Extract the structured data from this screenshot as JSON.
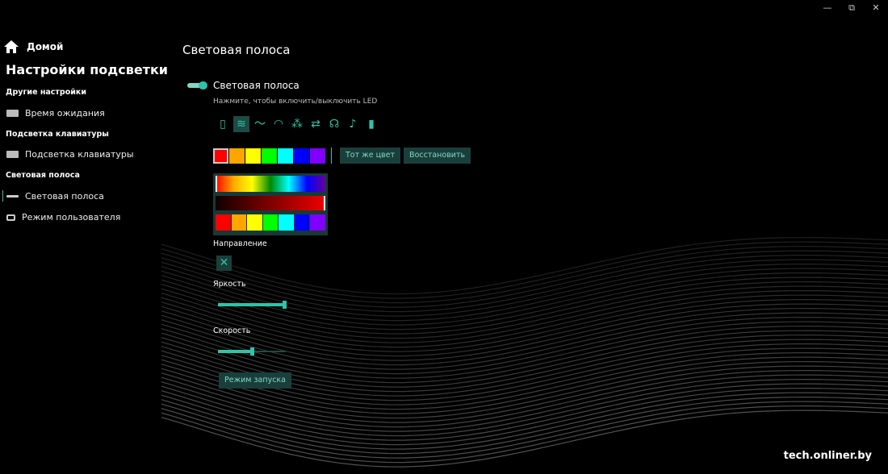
{
  "window": {
    "minimize": "—",
    "maximize": "⧉",
    "close": "✕"
  },
  "sidebar": {
    "home": "Домой",
    "title": "Настройки подсветки",
    "sections": [
      {
        "header": "Другие настройки",
        "items": [
          {
            "label": "Время ожидания",
            "icon": "timeout-icon"
          }
        ]
      },
      {
        "header": "Подсветка клавиатуры",
        "items": [
          {
            "label": "Подсветка клавиатуры",
            "icon": "keyboard-icon"
          }
        ]
      },
      {
        "header": "Световая полоса",
        "items": [
          {
            "label": "Световая полоса",
            "icon": "light-bar-icon",
            "selected": true
          },
          {
            "label": "Режим пользователя",
            "icon": "user-mode-icon"
          }
        ]
      }
    ]
  },
  "main": {
    "title": "Световая полоса",
    "toggle_label": "Световая полоса",
    "toggle_on": true,
    "hint": "Нажмите, чтобы включить/выключить LED",
    "effects": [
      {
        "icon": "static-icon",
        "glyph": "▯"
      },
      {
        "icon": "wind-icon",
        "glyph": "≋",
        "active": true
      },
      {
        "icon": "wave-icon",
        "glyph": "〜"
      },
      {
        "icon": "rainbow-icon",
        "glyph": "◠"
      },
      {
        "icon": "color-mix-icon",
        "glyph": "⁂"
      },
      {
        "icon": "swap-icon",
        "glyph": "⇄"
      },
      {
        "icon": "head-icon",
        "glyph": "☊"
      },
      {
        "icon": "music-icon",
        "glyph": "♪"
      },
      {
        "icon": "battery-icon",
        "glyph": "▮"
      }
    ],
    "swatches": [
      "#ff0000",
      "#ffa500",
      "#ffff00",
      "#00ff00",
      "#00ffff",
      "#0000ff",
      "#8000ff"
    ],
    "selected_swatch": 0,
    "same_color_button": "Тот же цвет",
    "restore_button": "Восстановить",
    "picker_colors": [
      "#ff0000",
      "#ffa500",
      "#ffff00",
      "#00ff00",
      "#00ffff",
      "#0000ff",
      "#8000ff"
    ],
    "hue_position": 0.0,
    "shade_position": 1.0,
    "direction_label": "Направление",
    "direction_icon": "close-icon",
    "brightness_label": "Яркость",
    "brightness": 1.0,
    "speed_label": "Скорость",
    "speed": 0.5,
    "launch_button": "Режим запуска",
    "accent": "#2ec4a8"
  },
  "watermark": "tech.onliner.by"
}
